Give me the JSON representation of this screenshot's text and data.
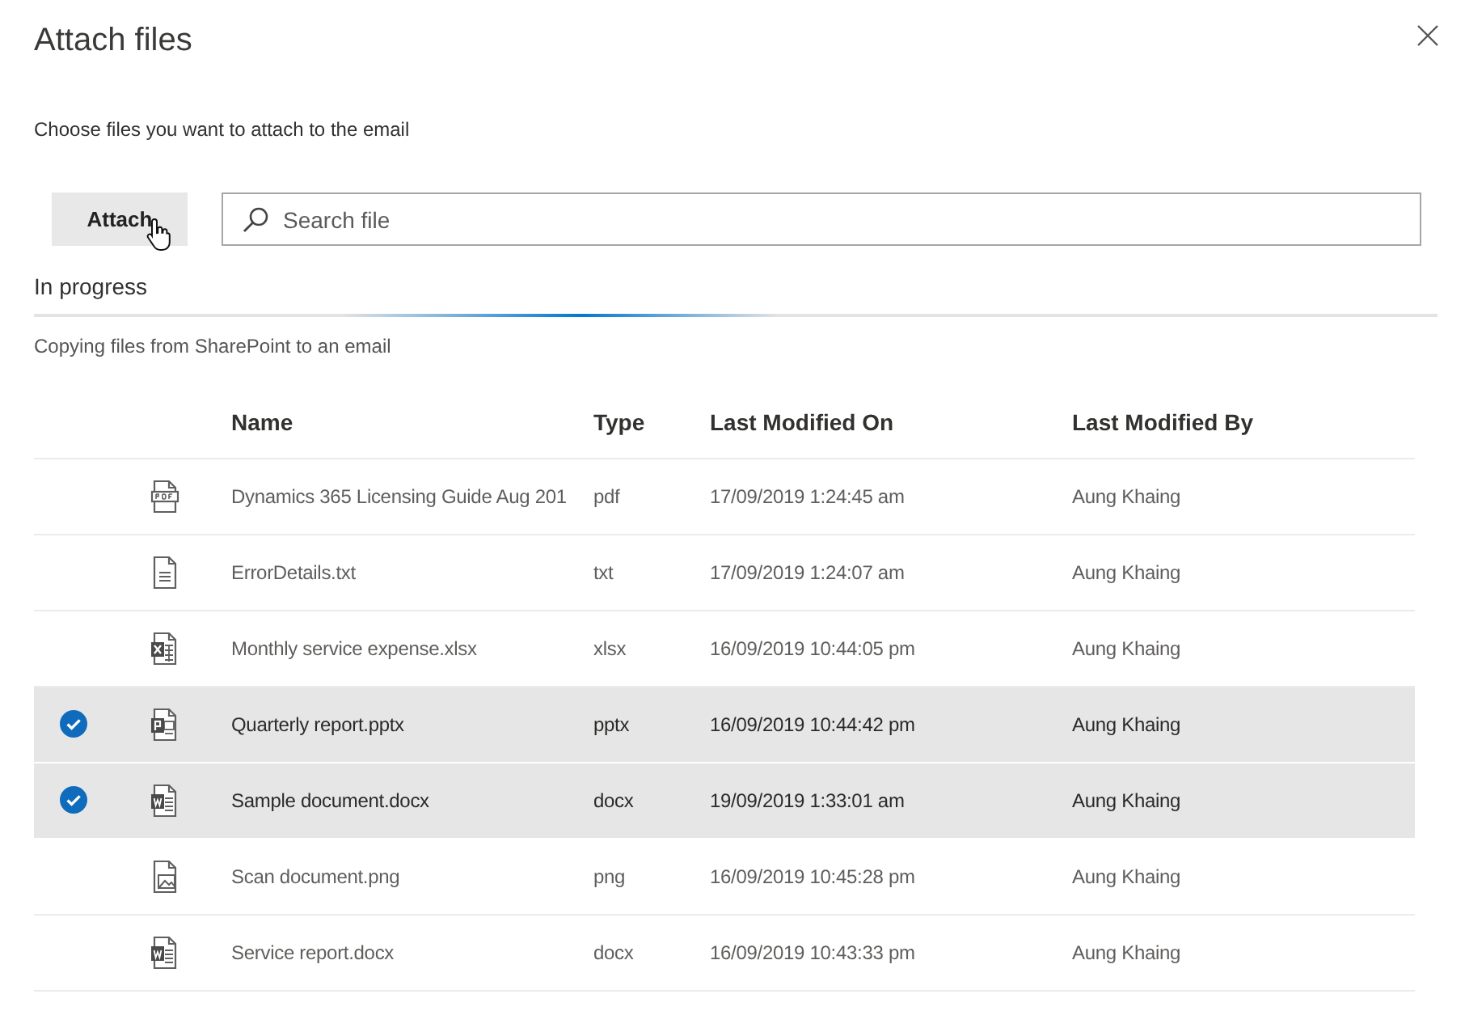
{
  "dialog": {
    "title": "Attach files",
    "instruction": "Choose files you want to attach to the email"
  },
  "toolbar": {
    "attach_button": "Attach",
    "search": {
      "placeholder": "Search file"
    }
  },
  "progress": {
    "label": "In progress",
    "message": "Copying files from SharePoint to an email"
  },
  "table": {
    "columns": [
      "Name",
      "Type",
      "Last Modified On",
      "Last Modified By"
    ],
    "rows": [
      {
        "kind": "pdf",
        "name": "Dynamics 365 Licensing Guide Aug 201",
        "type": "pdf",
        "modified_on": "17/09/2019 1:24:45 am",
        "modified_by": "Aung Khaing",
        "selected": false
      },
      {
        "kind": "text",
        "name": "ErrorDetails.txt",
        "type": "txt",
        "modified_on": "17/09/2019 1:24:07 am",
        "modified_by": "Aung Khaing",
        "selected": false
      },
      {
        "kind": "spreadsheet",
        "name": "Monthly service expense.xlsx",
        "type": "xlsx",
        "modified_on": "16/09/2019 10:44:05 pm",
        "modified_by": "Aung Khaing",
        "selected": false
      },
      {
        "kind": "presentation",
        "name": "Quarterly report.pptx",
        "type": "pptx",
        "modified_on": "16/09/2019 10:44:42 pm",
        "modified_by": "Aung Khaing",
        "selected": true
      },
      {
        "kind": "word",
        "name": "Sample document.docx",
        "type": "docx",
        "modified_on": "19/09/2019 1:33:01 am",
        "modified_by": "Aung Khaing",
        "selected": true
      },
      {
        "kind": "image",
        "name": "Scan document.png",
        "type": "png",
        "modified_on": "16/09/2019 10:45:28 pm",
        "modified_by": "Aung Khaing",
        "selected": false
      },
      {
        "kind": "word",
        "name": "Service report.docx",
        "type": "docx",
        "modified_on": "16/09/2019 10:43:33 pm",
        "modified_by": "Aung Khaing",
        "selected": false
      }
    ]
  }
}
